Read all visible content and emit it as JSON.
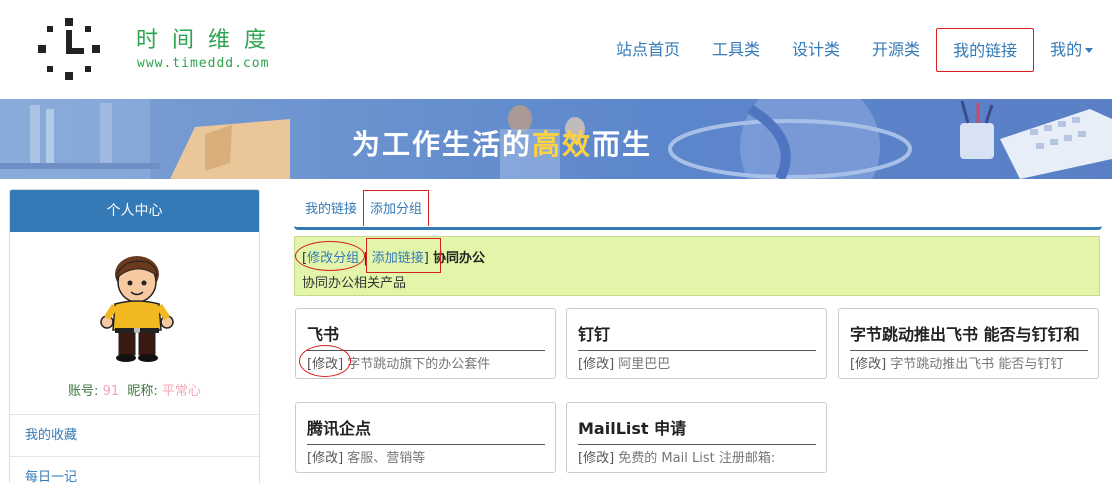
{
  "site": {
    "title": "时间维度",
    "url": "www.timeddd.com"
  },
  "nav": {
    "items": [
      {
        "label": "站点首页"
      },
      {
        "label": "工具类"
      },
      {
        "label": "设计类"
      },
      {
        "label": "开源类"
      },
      {
        "label": "我的链接",
        "active": true
      },
      {
        "label": "我的"
      }
    ]
  },
  "banner": {
    "text_before": "为工作生活的",
    "text_highlight": "高效",
    "text_after": "而生"
  },
  "sidebar": {
    "header": "个人中心",
    "account_label": "账号:",
    "account_value": "91",
    "nickname_label": "昵称:",
    "nickname_value": "平常心",
    "links": [
      {
        "label": "我的收藏"
      },
      {
        "label": "每日一记"
      }
    ]
  },
  "tabs": [
    {
      "label": "我的链接"
    },
    {
      "label": "添加分组",
      "active": true
    }
  ],
  "group": {
    "edit_label": "修改分组",
    "separator": "|",
    "add_label": "添加链接",
    "name": "协同办公",
    "description": "协同办公相关产品"
  },
  "cards": [
    {
      "title": "飞书",
      "edit": "[修改]",
      "desc": "字节跳动旗下的办公套件"
    },
    {
      "title": "钉钉",
      "edit": "[修改]",
      "desc": "阿里巴巴"
    },
    {
      "title": "字节跳动推出飞书 能否与钉钉和",
      "edit": "[修改]",
      "desc": "字节跳动推出飞书 能否与钉钉"
    },
    {
      "title": "腾讯企点",
      "edit": "[修改]",
      "desc": "客服、营销等"
    },
    {
      "title": "MailList 申请",
      "edit": "[修改]",
      "desc": "免费的 Mail List 注册邮箱:"
    }
  ],
  "colors": {
    "primary": "#337ab7",
    "logo_green": "#2da44e",
    "highlight_red": "#d9201f",
    "group_bg": "#e2f5a9"
  }
}
